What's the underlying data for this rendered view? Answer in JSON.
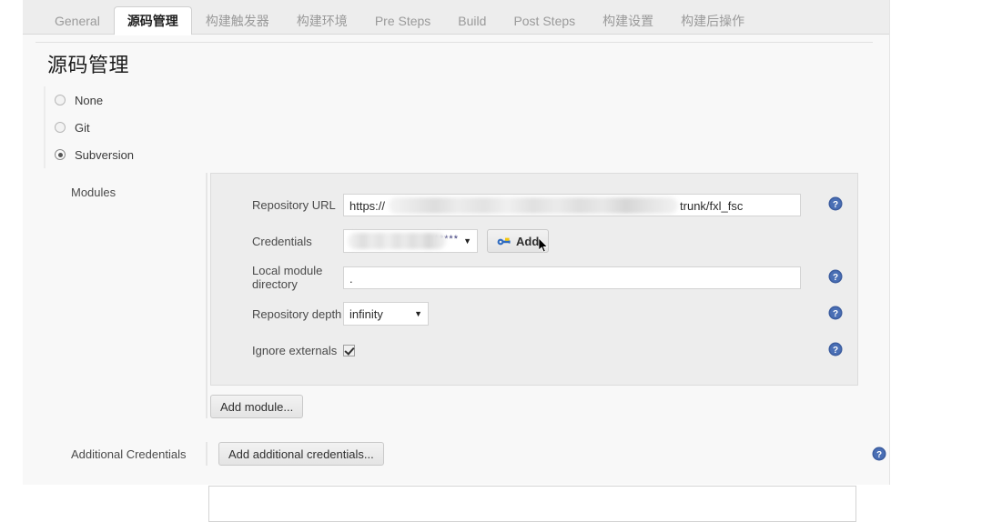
{
  "tabs": [
    {
      "label": "General",
      "active": false
    },
    {
      "label": "源码管理",
      "active": true
    },
    {
      "label": "构建触发器",
      "active": false
    },
    {
      "label": "构建环境",
      "active": false
    },
    {
      "label": "Pre Steps",
      "active": false
    },
    {
      "label": "Build",
      "active": false
    },
    {
      "label": "Post Steps",
      "active": false
    },
    {
      "label": "构建设置",
      "active": false
    },
    {
      "label": "构建后操作",
      "active": false
    }
  ],
  "section": {
    "heading": "源码管理"
  },
  "scm_options": [
    {
      "label": "None",
      "selected": false
    },
    {
      "label": "Git",
      "selected": false
    },
    {
      "label": "Subversion",
      "selected": true
    }
  ],
  "modules": {
    "side_label": "Modules",
    "fields": {
      "repository_url": {
        "label": "Repository URL",
        "value_prefix": "https://",
        "value_suffix": "trunk/fxl_fsc",
        "redacted": true
      },
      "credentials": {
        "label": "Credentials",
        "value_masked": "*****",
        "redacted": true,
        "add_button": "Add",
        "add_icon": "key-icon"
      },
      "local_module_directory": {
        "label": "Local module directory",
        "value": "."
      },
      "repository_depth": {
        "label": "Repository depth",
        "value": "infinity"
      },
      "ignore_externals": {
        "label": "Ignore externals",
        "checked": true
      }
    },
    "add_module_button": "Add module..."
  },
  "additional_credentials": {
    "label": "Additional Credentials",
    "button": "Add additional credentials..."
  },
  "icons": {
    "help": "help-icon",
    "caret": "▼"
  },
  "colors": {
    "help_blue": "#3b5c9e",
    "tab_active_text": "#1f1f1f",
    "tab_inactive_text": "#9a9a9a",
    "panel_bg": "#ededed",
    "page_bg": "#f8f8f8"
  }
}
